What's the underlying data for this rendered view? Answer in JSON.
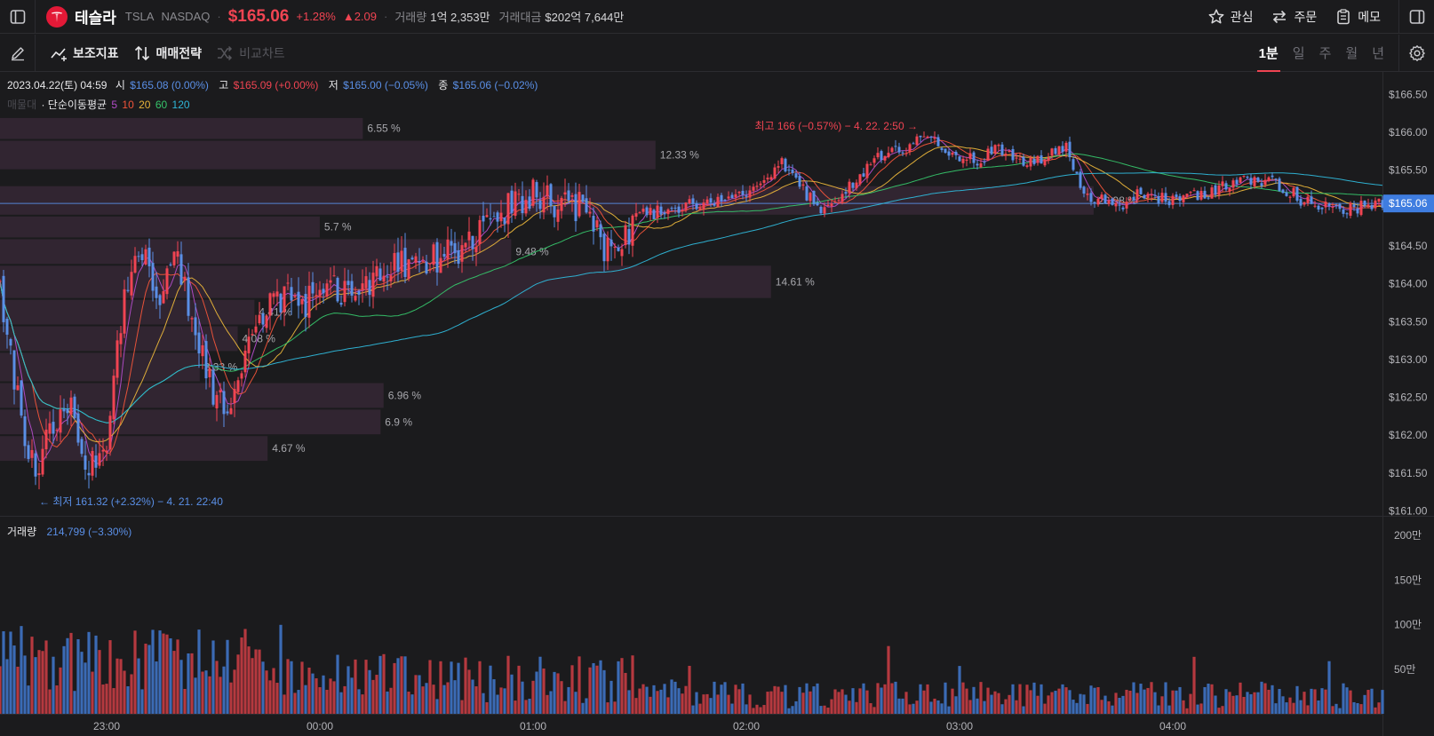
{
  "header": {
    "stock_name": "테슬라",
    "ticker": "TSLA",
    "exchange": "NASDAQ",
    "price": "$165.06",
    "change_pct": "+1.28%",
    "change_abs": "▲2.09",
    "volume_label": "거래량",
    "volume_value": "1억 2,353만",
    "amount_label": "거래대금",
    "amount_value": "$202억 7,644만",
    "actions": [
      {
        "label": "관심",
        "icon": "star-icon"
      },
      {
        "label": "주문",
        "icon": "swap-arrows-icon"
      },
      {
        "label": "메모",
        "icon": "clipboard-icon"
      }
    ]
  },
  "toolbar": {
    "indicator_label": "보조지표",
    "strategy_label": "매매전략",
    "compare_label": "비교차트",
    "periods": [
      "1분",
      "일",
      "주",
      "월",
      "년"
    ],
    "active_period": "1분"
  },
  "ohlc": {
    "date": "2023.04.22(토) 04:59",
    "open_label": "시",
    "open_value": "$165.08 (0.00%)",
    "high_label": "고",
    "high_value": "$165.09 (+0.00%)",
    "low_label": "저",
    "low_value": "$165.00 (−0.05%)",
    "close_label": "종",
    "close_value": "$165.06 (−0.02%)"
  },
  "indicator": {
    "faded_label": "매물대",
    "ma_label": "· 단순이동평균",
    "periods": [
      "5",
      "10",
      "20",
      "60",
      "120"
    ],
    "colors": [
      "#b24cc9",
      "#f0543a",
      "#e8b43a",
      "#36c46a",
      "#2fb6d8"
    ]
  },
  "annotations": {
    "high": "최고 166 (−0.57%) − 4. 22. 2:50 →",
    "low": "← 최저 161.32 (+2.32%) − 4. 21. 22:40"
  },
  "volume_panel": {
    "label": "거래량",
    "value": "214,799 (−3.30%)"
  },
  "colors": {
    "up": "#f04452",
    "down": "#5a8fe6",
    "current_price_bg": "#3f7de0",
    "background": "#1b1b1d"
  },
  "chart_data": {
    "type": "candlestick",
    "symbol": "TSLA",
    "interval": "1분",
    "current_price": 165.06,
    "current_price_label": "$165.06",
    "price_ticks": [
      "$166.50",
      "$166.00",
      "$165.50",
      "$165.06",
      "$164.50",
      "$164.00",
      "$163.50",
      "$163.00",
      "$162.50",
      "$162.00",
      "$161.50",
      "$161.00"
    ],
    "price_tick_values": [
      166.5,
      166.0,
      165.5,
      165.06,
      164.5,
      164.0,
      163.5,
      163.0,
      162.5,
      162.0,
      161.5,
      161.0
    ],
    "price_range": [
      160.75,
      166.6
    ],
    "volume_ticks": [
      "200만",
      "150만",
      "100만",
      "50만"
    ],
    "volume_tick_values": [
      200,
      150,
      100,
      50
    ],
    "volume_range_10k": [
      0,
      200
    ],
    "time_ticks": [
      "23:00",
      "00:00",
      "01:00",
      "02:00",
      "03:00",
      "04:00"
    ],
    "session": {
      "start": "22:30",
      "end": "05:00"
    },
    "high": {
      "price": 166,
      "time": "2:50"
    },
    "low": {
      "price": 161.32,
      "time": "22:40"
    },
    "price_close_path": {
      "times": [
        "22:30",
        "22:35",
        "22:40",
        "22:45",
        "22:50",
        "22:55",
        "23:00",
        "23:05",
        "23:10",
        "23:15",
        "23:20",
        "23:25",
        "23:30",
        "23:35",
        "23:40",
        "23:45",
        "23:50",
        "23:55",
        "00:00",
        "00:10",
        "00:20",
        "00:30",
        "00:40",
        "00:50",
        "01:00",
        "01:05",
        "01:15",
        "01:20",
        "01:25",
        "01:30",
        "01:40",
        "01:50",
        "02:00",
        "02:10",
        "02:20",
        "02:25",
        "02:35",
        "02:45",
        "02:50",
        "02:55",
        "03:05",
        "03:10",
        "03:20",
        "03:30",
        "03:35",
        "03:45",
        "03:50",
        "04:00",
        "04:10",
        "04:20",
        "04:30",
        "04:40",
        "04:50",
        "04:59"
      ],
      "values": [
        164.0,
        162.5,
        161.4,
        162.2,
        162.3,
        161.5,
        162.0,
        163.8,
        164.4,
        163.9,
        164.3,
        163.4,
        162.6,
        162.3,
        163.1,
        163.6,
        163.9,
        163.7,
        163.9,
        163.9,
        164.2,
        164.3,
        164.5,
        164.9,
        165.2,
        165.1,
        165.0,
        164.4,
        164.5,
        164.9,
        165.0,
        165.1,
        165.2,
        165.6,
        165.0,
        165.1,
        165.6,
        165.8,
        166.0,
        165.8,
        165.6,
        165.8,
        165.6,
        165.8,
        165.2,
        165.0,
        165.2,
        165.1,
        165.2,
        165.4,
        165.3,
        165.0,
        165.0,
        165.06
      ]
    },
    "moving_averages": [
      "5",
      "10",
      "20",
      "60",
      "120"
    ],
    "volume_profile": [
      {
        "price_low": 165.9,
        "price_high": 166.2,
        "share": "6.55 %"
      },
      {
        "price_low": 165.5,
        "price_high": 165.9,
        "share": "12.33 %"
      },
      {
        "price_low": 164.9,
        "price_high": 165.3,
        "share": "20.98 %"
      },
      {
        "price_low": 164.6,
        "price_high": 164.9,
        "share": "5.7 %"
      },
      {
        "price_low": 164.25,
        "price_high": 164.6,
        "share": "9.48 %"
      },
      {
        "price_low": 163.8,
        "price_high": 164.25,
        "share": "14.61 %"
      },
      {
        "price_low": 163.45,
        "price_high": 163.8,
        "share": "4.41 %"
      },
      {
        "price_low": 163.1,
        "price_high": 163.45,
        "share": "4.08 %"
      },
      {
        "price_low": 162.7,
        "price_high": 163.1,
        "share": "3.33 %"
      },
      {
        "price_low": 162.35,
        "price_high": 162.7,
        "share": "6.96 %"
      },
      {
        "price_low": 162.0,
        "price_high": 162.35,
        "share": "6.9 %"
      },
      {
        "price_low": 161.65,
        "price_high": 162.0,
        "share": "4.67 %"
      }
    ]
  }
}
